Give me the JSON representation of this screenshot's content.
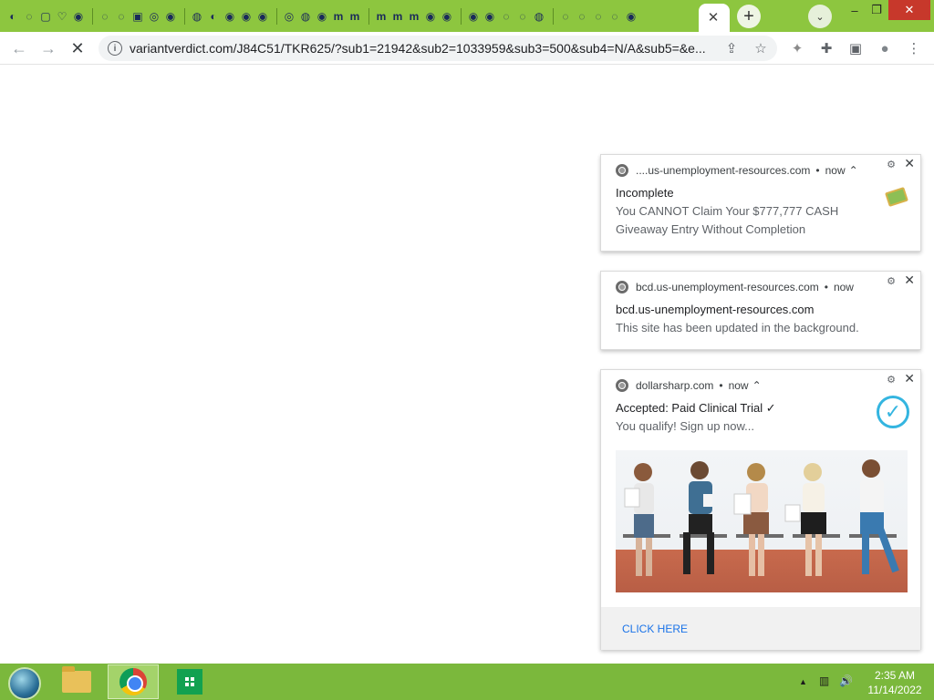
{
  "browser": {
    "tab_favicon_glyphs": [
      "◐",
      "◌",
      "▢",
      "♡",
      "◉",
      "◌",
      "◌",
      "▣",
      "◎",
      "◉",
      "◍",
      "◐",
      "◉",
      "◉",
      "◉",
      "◎",
      "◍",
      "◉",
      "m",
      "m",
      "m",
      "m",
      "m",
      "◉",
      "◉",
      "◉",
      "◉",
      "◌",
      "◌",
      "◍",
      "◌",
      "◌",
      "◌",
      "◌",
      "◉"
    ],
    "tab_close_glyph": "✕",
    "new_tab_glyph": "+",
    "tab_search_glyph": "⌄",
    "minimize_glyph": "–",
    "restore_glyph": "❐",
    "close_glyph": "✕",
    "back_glyph": "←",
    "forward_glyph": "→",
    "stop_glyph": "✕",
    "info_glyph": "i",
    "url": "variantverdict.com/J84C51/TKR625/?sub1=21942&sub2=1033959&sub3=500&sub4=N/A&sub5=&e...",
    "share_glyph": "⇪",
    "bookmark_glyph": "☆",
    "extension_glyph": "✦",
    "puzzle_glyph": "✚",
    "sidepanel_glyph": "▣",
    "profile_glyph": "●",
    "menu_glyph": "⋮"
  },
  "notifications": [
    {
      "site": "....us-unemployment-resources.com",
      "time": "now",
      "expand": "⌃",
      "settings_glyph": "⚙",
      "close_glyph": "✕",
      "title": "Incomplete",
      "body": "You CANNOT Claim Your $777,777 CASH Giveaway Entry Without Completion"
    },
    {
      "site": "bcd.us-unemployment-resources.com",
      "time": "now",
      "settings_glyph": "⚙",
      "close_glyph": "✕",
      "title": "bcd.us-unemployment-resources.com",
      "body": "This site has been updated in the background."
    },
    {
      "site": "dollarsharp.com",
      "time": "now",
      "expand": "⌃",
      "settings_glyph": "⚙",
      "close_glyph": "✕",
      "title": "Accepted: Paid Clinical Trial ✓",
      "body": "You qualify! Sign up now...",
      "check_glyph": "✓",
      "action": "CLICK HERE"
    }
  ],
  "taskbar": {
    "tray_arrow": "▲",
    "tray_network": "▥",
    "tray_volume": "🔊",
    "time": "2:35 AM",
    "date": "11/14/2022"
  },
  "colors": {
    "tabstrip": "#8dc63f",
    "taskbar": "#7bb83c",
    "link": "#1a73e8",
    "check": "#34b5e0",
    "close_button": "#c7382b"
  }
}
